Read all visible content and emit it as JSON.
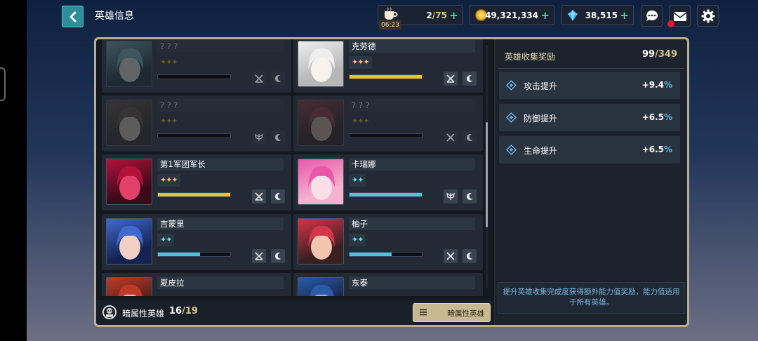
{
  "header": {
    "title": "英雄信息"
  },
  "resources": {
    "stamina": {
      "value": "2",
      "max": "/75",
      "timer": "06:23",
      "icon": "coffee-icon"
    },
    "gold": {
      "value": "49,321,334",
      "icon": "gold-coin-icon"
    },
    "gems": {
      "value": "38,515",
      "icon": "gem-icon"
    },
    "plus": "+"
  },
  "colors": {
    "accent_gold": "#f2c12e",
    "accent_blue": "#4cc6dc",
    "back_button": "#2d8e9a",
    "notification": "#e8162c"
  },
  "heroes": [
    {
      "name": "? ? ?",
      "stars": "✦✦✦",
      "star_color": "gold",
      "locked": true,
      "progress": 0,
      "type_icon": "sword-cross-icon",
      "element_icon": "moon-icon"
    },
    {
      "name": "克劳德",
      "stars": "✦✦✦",
      "star_color": "gold",
      "locked": false,
      "progress": 1.0,
      "type_icon": "sword-cross-icon",
      "element_icon": "moon-icon"
    },
    {
      "name": "? ? ?",
      "stars": "✦✦✦",
      "star_color": "gold",
      "locked": true,
      "progress": 0,
      "type_icon": "wings-icon",
      "element_icon": "moon-icon"
    },
    {
      "name": "? ? ?",
      "stars": "✦✦✦",
      "star_color": "gold",
      "locked": true,
      "progress": 0,
      "type_icon": "crossed-swords-icon",
      "element_icon": "moon-icon"
    },
    {
      "name": "第1军团军长",
      "stars": "✦✦✦",
      "star_color": "gold",
      "locked": false,
      "progress": 1.0,
      "type_icon": "sword-cross-icon",
      "element_icon": "moon-icon"
    },
    {
      "name": "卡瑞娜",
      "stars": "✦✦",
      "star_color": "blue",
      "locked": false,
      "progress": 1.0,
      "type_icon": "wings-icon",
      "element_icon": "moon-icon"
    },
    {
      "name": "吉蒙里",
      "stars": "✦✦",
      "star_color": "blue",
      "locked": false,
      "progress": 0.58,
      "type_icon": "sword-cross-icon",
      "element_icon": "moon-icon"
    },
    {
      "name": "柚子",
      "stars": "✦✦",
      "star_color": "blue",
      "locked": false,
      "progress": 0.58,
      "type_icon": "crossed-swords-icon",
      "element_icon": "moon-icon"
    },
    {
      "name": "夏皮拉",
      "stars": "",
      "star_color": "gold",
      "locked": false,
      "progress": 0,
      "type_icon": "",
      "element_icon": ""
    },
    {
      "name": "东泰",
      "stars": "",
      "star_color": "blue",
      "locked": false,
      "progress": 0,
      "type_icon": "",
      "element_icon": ""
    }
  ],
  "footer": {
    "label": "暗属性英雄",
    "count": "16",
    "max": "/19",
    "filter_label": "暗属性英雄"
  },
  "reward": {
    "title": "英雄收集奖励",
    "count": "99",
    "max": "/349",
    "stats": [
      {
        "label": "攻击提升",
        "value": "+9.4",
        "unit": "%"
      },
      {
        "label": "防御提升",
        "value": "+6.5",
        "unit": "%"
      },
      {
        "label": "生命提升",
        "value": "+6.5",
        "unit": "%"
      }
    ],
    "note": "提升英雄收集完成度获得额外能力值奖励，能力值适用于所有英雄。"
  }
}
